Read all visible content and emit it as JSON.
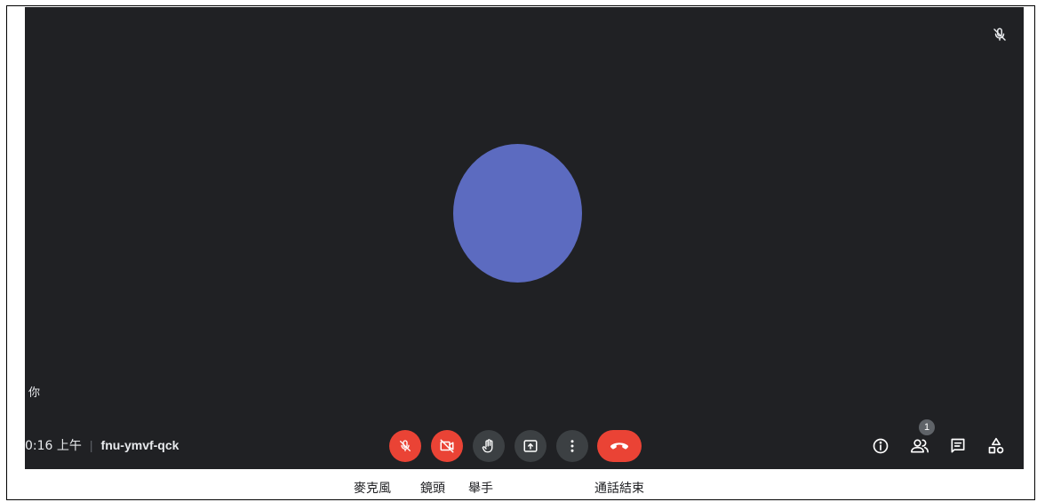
{
  "meeting": {
    "self_label": "你",
    "time": "0:16 上午",
    "separator": "|",
    "code": "fnu-ymvf-qck",
    "avatar_color": "#5c6bc0",
    "background_color": "#202124"
  },
  "controls": [
    {
      "name": "microphone-button",
      "icon": "mic-off-icon",
      "state": "off",
      "color": "#ea4335"
    },
    {
      "name": "camera-button",
      "icon": "videocam-off-icon",
      "state": "off",
      "color": "#ea4335"
    },
    {
      "name": "raise-hand-button",
      "icon": "hand-icon",
      "color": "#3c4043"
    },
    {
      "name": "present-button",
      "icon": "present-screen-icon",
      "color": "#3c4043"
    },
    {
      "name": "more-options-button",
      "icon": "more-vert-icon",
      "color": "#3c4043"
    },
    {
      "name": "end-call-button",
      "icon": "call-end-icon",
      "color": "#ea4335"
    }
  ],
  "right_toolbar": {
    "people_count": "1",
    "icons": [
      "info-icon",
      "people-icon",
      "chat-icon",
      "activities-icon"
    ]
  },
  "captions": {
    "mic": "麥克風",
    "camera": "鏡頭",
    "raise_hand": "舉手",
    "end_call": "通話結束"
  }
}
